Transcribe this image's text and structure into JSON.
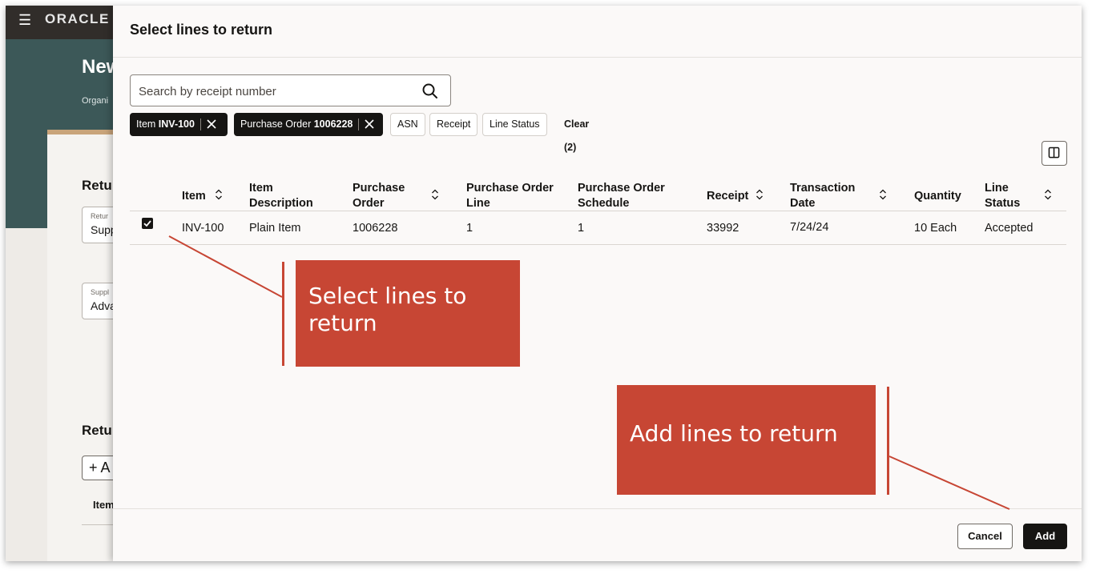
{
  "app": {
    "brand": "ORACLE",
    "bg_title": "New",
    "bg_subtitle": "Organi",
    "bg_section1": "Retu",
    "bg_field1": {
      "label": "Retur",
      "value": "Supp"
    },
    "bg_field2": {
      "label": "Suppl",
      "value": "Adva"
    },
    "bg_section2": "Retu",
    "bg_add": "+ A",
    "bg_col": "Item"
  },
  "dialog": {
    "title": "Select lines to return",
    "search": {
      "placeholder": "Search by receipt number",
      "value": ""
    },
    "chips": [
      {
        "label": "Item",
        "value": "INV-100"
      },
      {
        "label": "Purchase Order",
        "value": "1006228"
      }
    ],
    "filters": [
      "ASN",
      "Receipt",
      "Line Status"
    ],
    "clear_label": "Clear (2)",
    "columns": [
      {
        "line1": "Item",
        "line2": ""
      },
      {
        "line1": "Item",
        "line2": "Description"
      },
      {
        "line1": "Purchase",
        "line2": "Order"
      },
      {
        "line1": "Purchase Order",
        "line2": "Line"
      },
      {
        "line1": "Purchase Order",
        "line2": "Schedule"
      },
      {
        "line1": "Receipt",
        "line2": ""
      },
      {
        "line1": "Transaction",
        "line2": "Date"
      },
      {
        "line1": "Quantity",
        "line2": ""
      },
      {
        "line1": "Line",
        "line2": "Status"
      }
    ],
    "rows": [
      {
        "selected": true,
        "item": "INV-100",
        "description": "Plain Item",
        "purchase_order": "1006228",
        "po_line": "1",
        "po_schedule": "1",
        "receipt": "33992",
        "transaction_date": "7/24/24",
        "quantity": "10 Each",
        "line_status": "Accepted"
      }
    ],
    "cancel_label": "Cancel",
    "add_label": "Add"
  },
  "callouts": {
    "select_lines": "Select lines to return",
    "add_lines": "Add lines to return"
  },
  "colors": {
    "accent": "#c74634",
    "dark": "#161513",
    "hero": "#3c5858"
  }
}
